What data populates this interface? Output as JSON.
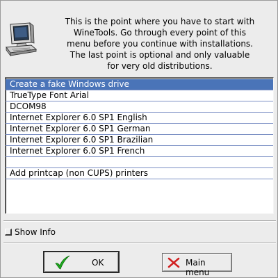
{
  "intro_lines": [
    "This is the point where you have to start with",
    "WineTools. Go through every point of this",
    "menu before you continue with installations.",
    "The last point is optional and only valuable",
    "for very old distributions."
  ],
  "menu_items": [
    "Create a fake Windows drive",
    "TrueType Font Arial",
    "DCOM98",
    "Internet Explorer 6.0 SP1 English",
    "Internet Explorer 6.0 SP1 German",
    "Internet Explorer 6.0 SP1 Brazilian",
    "Internet Explorer 6.0 SP1 French",
    "",
    "Add printcap (non CUPS) printers"
  ],
  "selected_index": 0,
  "show_info_label": "Show Info",
  "show_info_checked": false,
  "ok_label": "OK",
  "main_menu_label": "Main menu",
  "icons": {
    "header": "computer-icon",
    "ok": "checkmark-icon",
    "main_menu": "x-icon"
  },
  "colors": {
    "selection": "#4a74b8",
    "row_divider": "#7b8fc4",
    "checkmark": "#1faa1f",
    "x_mark": "#d12020"
  }
}
